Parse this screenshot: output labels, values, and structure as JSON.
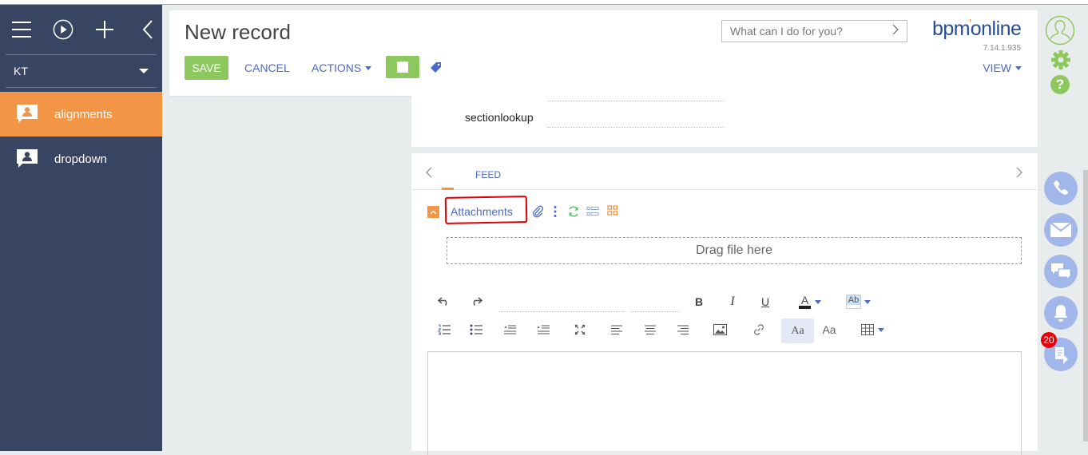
{
  "sidebar": {
    "top_icons": [
      "menu-icon",
      "play-icon",
      "add-icon",
      "collapse-icon"
    ],
    "workspace": "KT",
    "sections": [
      {
        "label": "alignments",
        "icon": "section-icon",
        "active": true
      },
      {
        "label": "dropdown",
        "icon": "section-icon",
        "active": false
      }
    ]
  },
  "header": {
    "title": "New record",
    "save_label": "SAVE",
    "cancel_label": "CANCEL",
    "actions_label": "ACTIONS",
    "view_label": "VIEW",
    "search_placeholder": "What can I do for you?",
    "logo_left": "bpm",
    "logo_dot": "'",
    "logo_right": "online",
    "version": "7.14.1.935"
  },
  "form": {
    "field_label": "sectionlookup",
    "field_value": ""
  },
  "tabs": {
    "items": [
      {
        "label": "FEED",
        "active": true
      }
    ]
  },
  "attachments": {
    "title": "Attachments",
    "dropzone": "Drag file here"
  },
  "editor": {
    "toolbar_row1": [
      "undo",
      "redo",
      "font-family",
      "font-size",
      "bold",
      "italic",
      "underline",
      "font-color",
      "highlight-color"
    ],
    "toolbar_row2": [
      "numbered-list",
      "bulleted-list",
      "outdent",
      "indent",
      "fullscreen",
      "align-left",
      "align-center",
      "align-right",
      "image",
      "link",
      "format-text",
      "clear-format",
      "table"
    ],
    "bold_label": "B",
    "italic_label": "I",
    "underline_label": "U",
    "font_color_label": "A",
    "highlight_label": "Ab",
    "format_label": "Aa",
    "clear_format_label": "Aa",
    "content": ""
  },
  "right_rail": {
    "items": [
      "profile",
      "settings",
      "help",
      "phone",
      "email",
      "chat",
      "notifications",
      "process"
    ],
    "help_label": "?",
    "process_badge": "20"
  },
  "colors": {
    "sidebar": "#374562",
    "accent_orange": "#f29544",
    "green": "#8cc85e",
    "link_blue": "#4a6bc8",
    "rail_button": "#a1b6e9",
    "badge_red": "#e8000b"
  }
}
